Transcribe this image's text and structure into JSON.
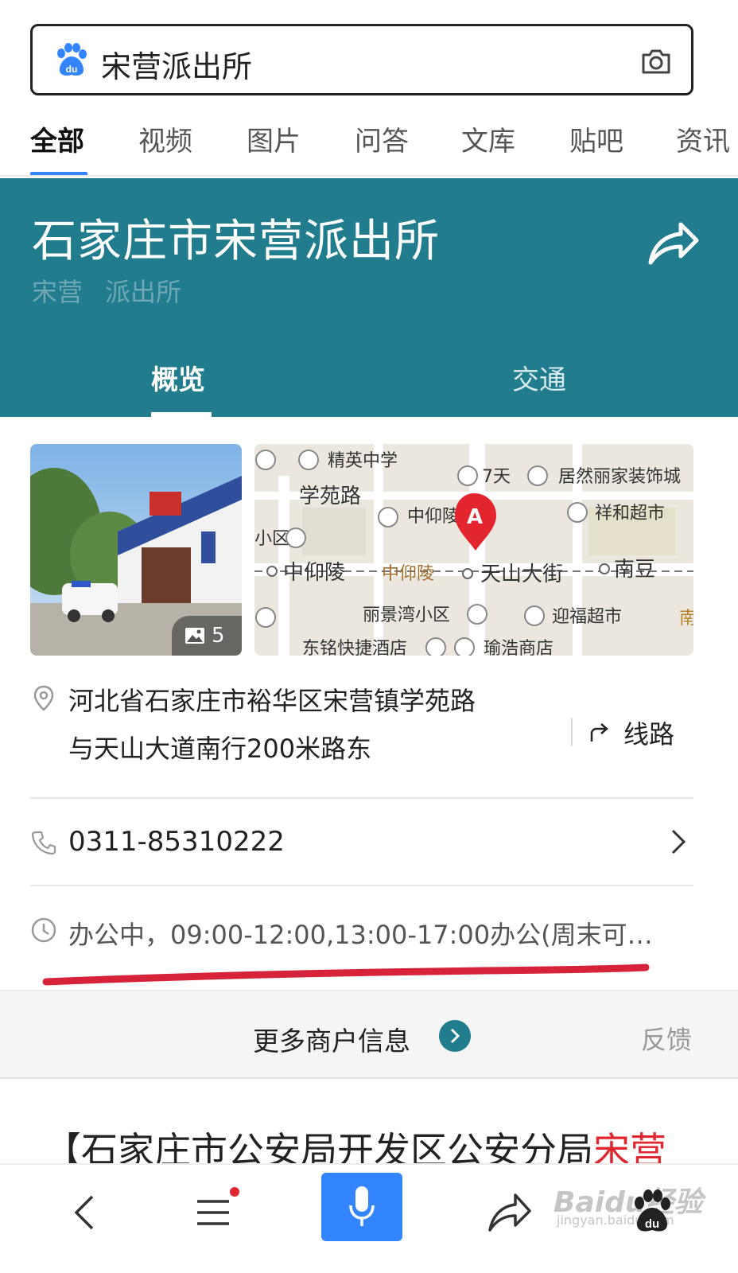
{
  "search": {
    "query": "宋营派出所",
    "logo_icon": "baidu-paw-icon",
    "camera_icon": "camera-icon"
  },
  "tabs": [
    {
      "label": "全部",
      "active": true
    },
    {
      "label": "视频"
    },
    {
      "label": "图片"
    },
    {
      "label": "问答"
    },
    {
      "label": "文库"
    },
    {
      "label": "贴吧"
    },
    {
      "label": "资讯"
    }
  ],
  "place": {
    "title": "石家庄市宋营派出所",
    "tags": [
      "宋营",
      "派出所"
    ],
    "share_icon": "share-icon",
    "sub_tabs": [
      {
        "label": "概览",
        "active": true
      },
      {
        "label": "交通"
      }
    ],
    "photo_count": "5",
    "map_pin_label": "A",
    "map_labels": [
      "精英中学",
      "7天",
      "居然丽家装饰城",
      "学苑路",
      "中仰陵中学",
      "祥和超市",
      "小区",
      "中仰陵",
      "中仰陵",
      "天山大街",
      "南豆",
      "丽景湾小区",
      "迎福超市",
      "东铭快捷酒店",
      "瑜浩商店",
      "南"
    ]
  },
  "info": {
    "address_line1": "河北省石家庄市裕华区宋营镇学苑路",
    "address_line2": "与天山大道南行200米路东",
    "route_label": "线路",
    "phone": "0311-85310222",
    "hours": "办公中，09:00-12:00,13:00-17:00办公(周末可…"
  },
  "more": {
    "label": "更多商户信息",
    "feedback": "反馈"
  },
  "next_result": {
    "prefix": "【石家庄市公安局开发区公安分局",
    "highlight": "宋营"
  },
  "watermark": {
    "main": "Baidu经验",
    "sub": "jingyan.baidu.com"
  },
  "colors": {
    "header_bg": "#217c8e",
    "accent_blue": "#3385ff",
    "highlight_red": "#e0262e"
  }
}
